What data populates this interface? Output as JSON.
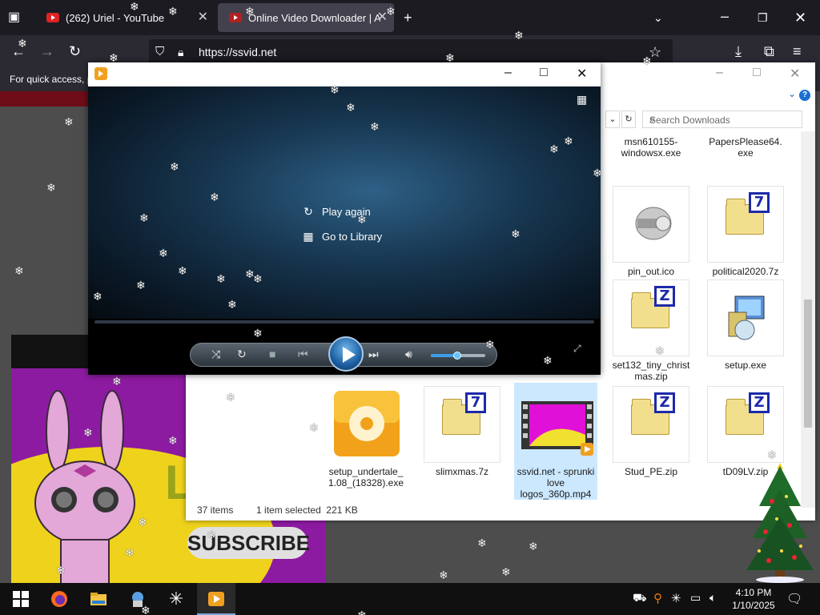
{
  "browser": {
    "tabs": [
      {
        "title": "(262) Uriel - YouTube"
      },
      {
        "title": "Online Video Downloader | All-"
      }
    ],
    "url": "https://ssvid.net",
    "bookmark_hint": "For quick access, p"
  },
  "thumbnail": {
    "subscribe_label": "SUBSCRIBE",
    "letter": "L"
  },
  "media_player": {
    "options": [
      {
        "label": "Play again",
        "icon": "replay-icon"
      },
      {
        "label": "Go to Library",
        "icon": "library-icon"
      }
    ]
  },
  "explorer": {
    "search_placeholder": "Search Downloads",
    "files": [
      {
        "name": "msn610155-windowsx.exe",
        "icon": "exe-icon"
      },
      {
        "name": "PapersPlease64.exe",
        "icon": "exe-icon"
      },
      {
        "name": "pin_out.ico",
        "icon": "ico-file-icon"
      },
      {
        "name": "political2020.7z",
        "icon": "7z-archive-icon"
      },
      {
        "name": "set132_tiny_christmas.zip",
        "icon": "zip-archive-icon"
      },
      {
        "name": "setup.exe",
        "icon": "installer-icon"
      },
      {
        "name": "setup_undertale_1.08_(18328).exe",
        "icon": "disc-installer-icon"
      },
      {
        "name": "slimxmas.7z",
        "icon": "7z-archive-icon"
      },
      {
        "name": "ssvid.net - sprunki love logos_360p.mp4",
        "icon": "video-file-icon"
      },
      {
        "name": "Stud_PE.zip",
        "icon": "zip-archive-icon"
      },
      {
        "name": "tD09LV.zip",
        "icon": "zip-archive-icon"
      }
    ],
    "status": {
      "item_count": "37 items",
      "selection": "1 item selected  221 KB"
    }
  },
  "taskbar": {
    "time": "4:10 PM",
    "date": "1/10/2025",
    "pinned": [
      "start-icon",
      "firefox-icon",
      "file-explorer-icon",
      "app-icon",
      "snowflake-app-icon",
      "media-player-icon"
    ]
  }
}
